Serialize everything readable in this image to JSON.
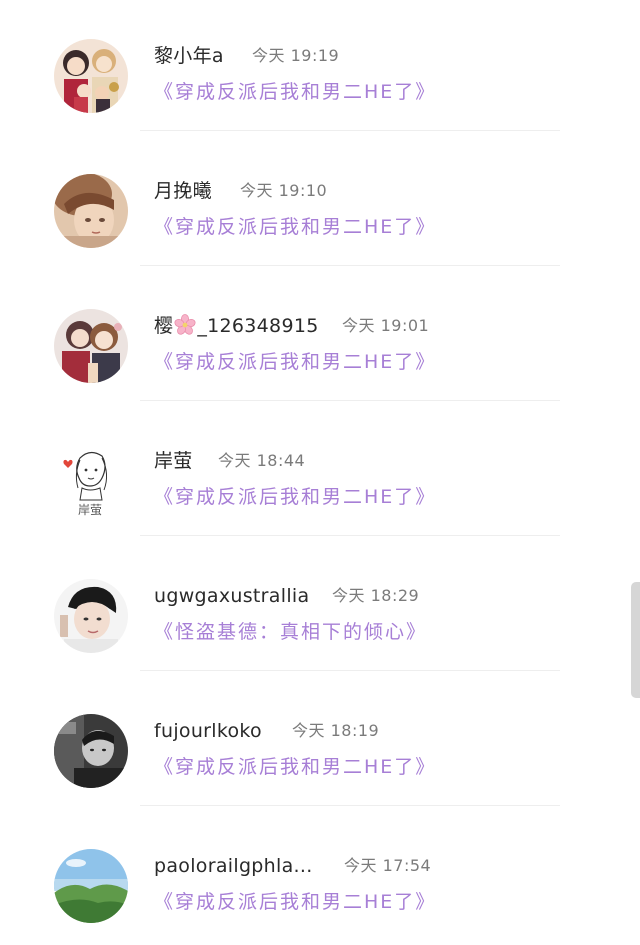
{
  "comments": [
    {
      "name": "黎小年a",
      "time": "今天 19:19",
      "book": "《穿成反派后我和男二HE了》",
      "avatar": "anime-group-avatar"
    },
    {
      "name": "月挽曦",
      "time": "今天 19:10",
      "book": "《穿成反派后我和男二HE了》",
      "avatar": "sepia-portrait-avatar"
    },
    {
      "name_prefix": "樱",
      "name_suffix": "_126348915",
      "name_emoji": "cherry-blossom-icon",
      "time": "今天 19:01",
      "book": "《穿成反派后我和男二HE了》",
      "avatar": "anime-duo-avatar"
    },
    {
      "name": "岸萤",
      "time": "今天 18:44",
      "book": "《穿成反派后我和男二HE了》",
      "avatar": "line-sketch-girl-avatar",
      "avatar_text": "岸萤"
    },
    {
      "name": "ugwgaxustrallia",
      "time": "今天 18:29",
      "book": "《怪盗基德：真相下的倾心》",
      "avatar": "short-hair-person-avatar"
    },
    {
      "name": "fujourlkoko",
      "time": "今天 18:19",
      "book": "《穿成反派后我和男二HE了》",
      "avatar": "monochrome-portrait-avatar"
    },
    {
      "name": "paolorailgphla...",
      "time": "今天 17:54",
      "book": "《穿成反派后我和男二HE了》",
      "avatar": "landscape-avatar"
    }
  ]
}
